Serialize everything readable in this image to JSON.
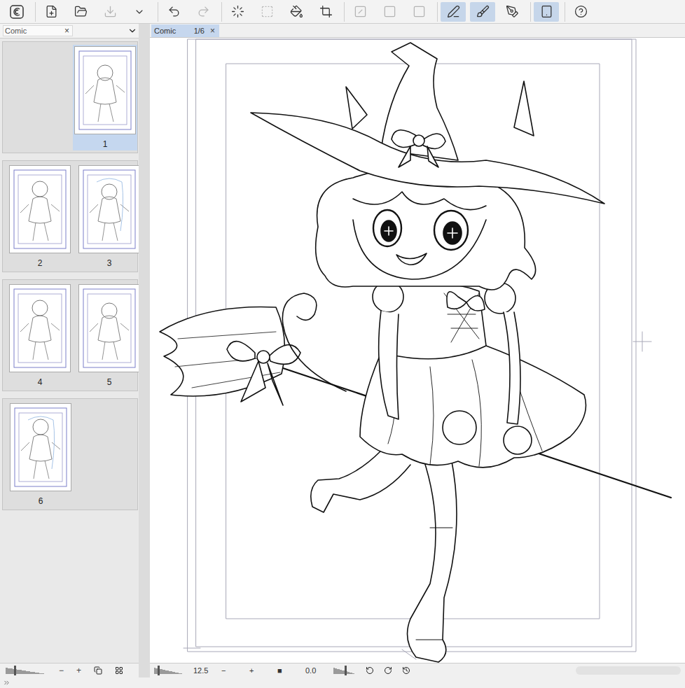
{
  "toolbar": {
    "groups": [
      [
        {
          "selected": false,
          "disabled": false
        }
      ],
      [
        {
          "selected": false,
          "disabled": false
        },
        {
          "selected": false,
          "disabled": false
        },
        {
          "selected": false,
          "disabled": true
        },
        {
          "selected": false,
          "disabled": false
        }
      ],
      [
        {
          "selected": false,
          "disabled": false
        },
        {
          "selected": false,
          "disabled": true
        }
      ],
      [
        {
          "selected": false,
          "disabled": false
        },
        {
          "selected": false,
          "disabled": true
        },
        {
          "selected": false,
          "disabled": false
        },
        {
          "selected": false,
          "disabled": false
        }
      ],
      [
        {
          "selected": false,
          "disabled": true
        },
        {
          "selected": false,
          "disabled": true
        },
        {
          "selected": false,
          "disabled": true
        }
      ],
      [
        {
          "selected": true,
          "disabled": false
        },
        {
          "selected": true,
          "disabled": false
        },
        {
          "selected": false,
          "disabled": false
        }
      ],
      [
        {
          "selected": true,
          "disabled": false
        }
      ],
      [
        {
          "selected": false,
          "disabled": false
        }
      ]
    ]
  },
  "panel": {
    "title": "Comic",
    "close": "×",
    "groups": [
      {
        "pages": [
          {
            "number": "1",
            "selected": true,
            "side": "right"
          }
        ]
      },
      {
        "pages": [
          {
            "number": "2",
            "selected": false,
            "side": "left"
          },
          {
            "number": "3",
            "selected": false,
            "side": "right"
          }
        ]
      },
      {
        "pages": [
          {
            "number": "4",
            "selected": false,
            "side": "left"
          },
          {
            "number": "5",
            "selected": false,
            "side": "right"
          }
        ]
      },
      {
        "pages": [
          {
            "number": "6",
            "selected": false,
            "side": "left"
          }
        ]
      }
    ],
    "footer": {
      "level": 0.2,
      "minus": "−",
      "plus": "+"
    }
  },
  "tab": {
    "label": "Comic",
    "count": "1/6",
    "close": "×",
    "selected": true
  },
  "status_bar": {
    "zoom_level": 0.12,
    "zoom": "12.5",
    "minus": "−",
    "plus": "+",
    "fit": "■",
    "angle": "0.0",
    "angle_level": 0.5
  }
}
